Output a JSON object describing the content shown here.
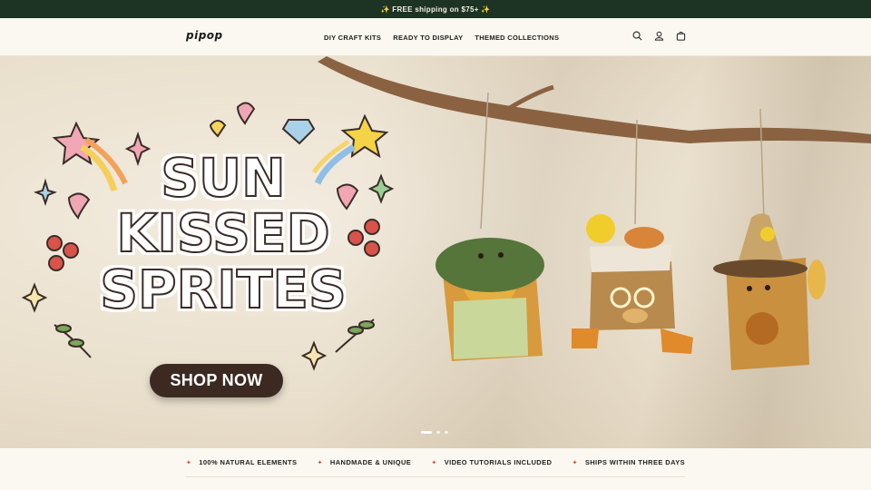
{
  "announcement": "✨ FREE shipping on $75+ ✨",
  "header": {
    "logo": "pipop",
    "nav": [
      "DIY CRAFT KITS",
      "READY TO DISPLAY",
      "THEMED COLLECTIONS"
    ],
    "icons": [
      "search-icon",
      "account-icon",
      "cart-icon"
    ]
  },
  "hero": {
    "title_lines": [
      "SUN",
      "KISSED",
      "SPRITES"
    ],
    "cta": "SHOP NOW",
    "slides": 3,
    "active_slide": 1
  },
  "features": [
    "100% NATURAL ELEMENTS",
    "HANDMADE & UNIQUE",
    "VIDEO TUTORIALS INCLUDED",
    "SHIPS WITHIN THREE DAYS"
  ],
  "colors": {
    "announcement_bg": "#1d3324",
    "cta_bg": "#3c2a22",
    "feature_star": "#d04a3c"
  }
}
